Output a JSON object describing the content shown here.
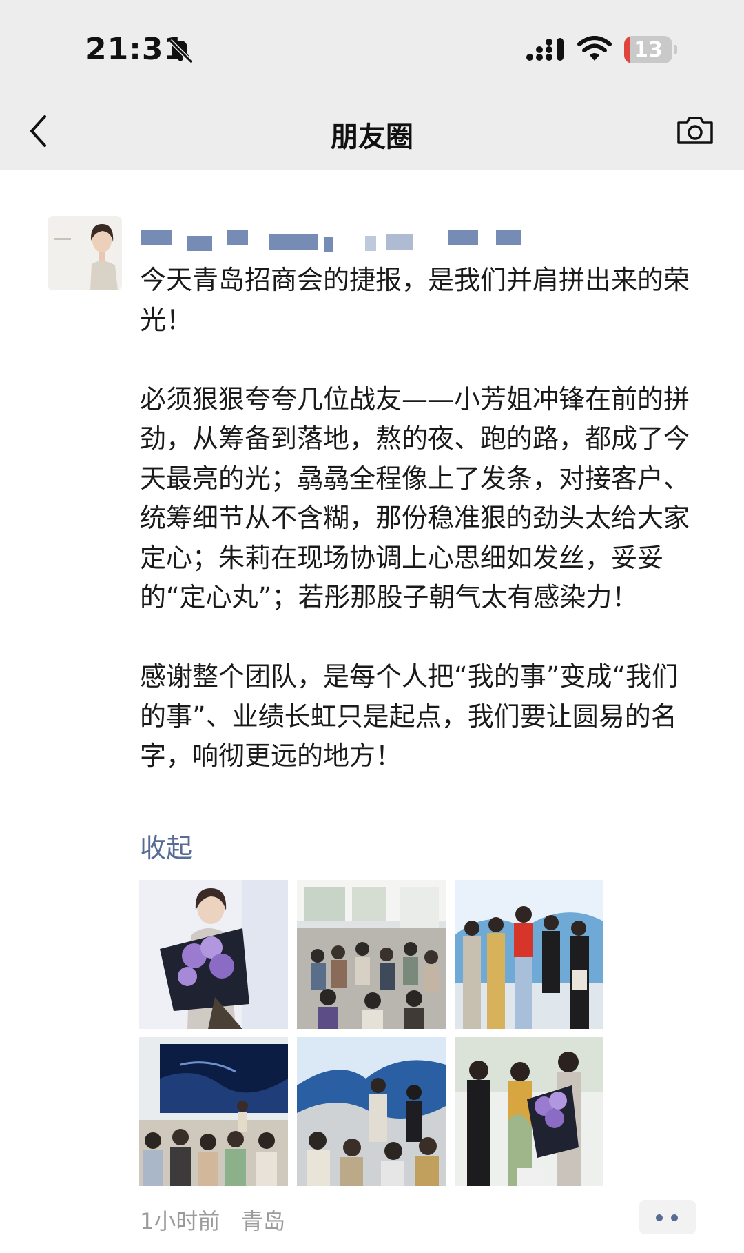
{
  "status_bar": {
    "time": "21:31",
    "battery": "13",
    "battery_level": 0.13
  },
  "nav": {
    "title": "朋友圈"
  },
  "post": {
    "paragraphs": [
      "今天青岛招商会的捷报，是我们并肩拼出来的荣光！",
      "必须狠狠夸夸几位战友——小芳姐冲锋在前的拼劲，从筹备到落地，熬的夜、跑的路，都成了今天最亮的光；骉骉全程像上了发条，对接客户、统筹细节从不含糊，那份稳准狠的劲头太给大家定心；朱莉在现场协调上心思细如发丝，妥妥的“定心丸”；若彤那股子朝气太有感染力！",
      "感谢整个团队，是每个人把“我的事”变成“我们的事”、业绩长虹只是起点，我们要让圆易的名字，响彻更远的地方！"
    ],
    "collapse_label": "收起",
    "time_ago": "1小时前",
    "location": "青岛"
  },
  "icons": {
    "back": "chevron-left-icon",
    "camera": "camera-icon",
    "mute": "bell-slash-icon",
    "signal": "cellular-signal-icon",
    "wifi": "wifi-icon",
    "more": "more-dots-icon"
  },
  "colors": {
    "link": "#576b95",
    "header_bg": "#ededed",
    "meta": "#9b9b9b"
  }
}
